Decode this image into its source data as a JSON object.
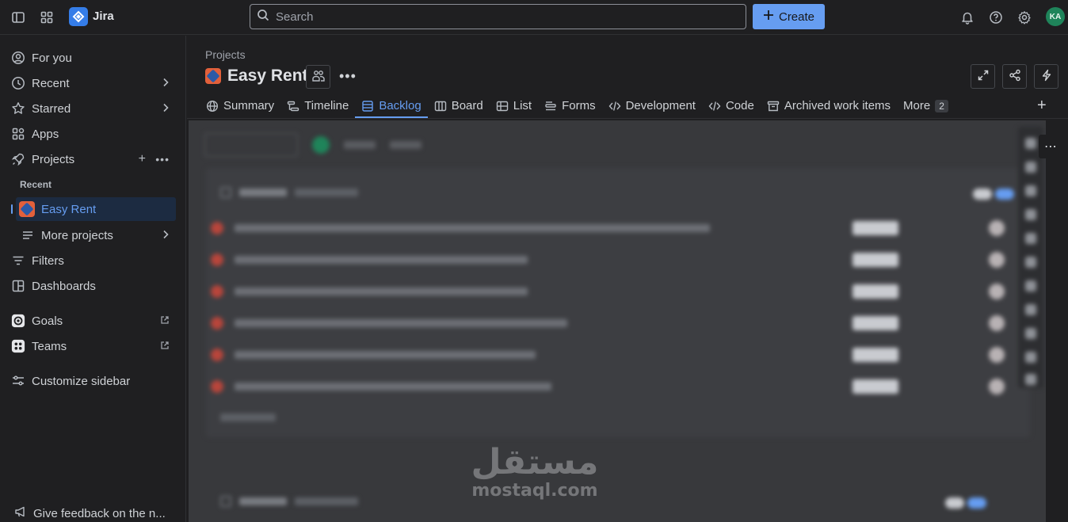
{
  "topbar": {
    "brand": "Jira",
    "search_placeholder": "Search",
    "create_label": "Create",
    "avatar_initials": "KA"
  },
  "sidebar": {
    "for_you": "For you",
    "recent": "Recent",
    "starred": "Starred",
    "apps": "Apps",
    "projects": "Projects",
    "recent_heading": "Recent",
    "easy_rent": "Easy Rent",
    "more_projects": "More projects",
    "filters": "Filters",
    "dashboards": "Dashboards",
    "goals": "Goals",
    "teams": "Teams",
    "customize": "Customize sidebar",
    "feedback": "Give feedback on the n..."
  },
  "header": {
    "breadcrumb": "Projects",
    "project_name": "Easy Rent"
  },
  "tabs": [
    {
      "label": "Summary",
      "icon": "globe-icon"
    },
    {
      "label": "Timeline",
      "icon": "timeline-icon"
    },
    {
      "label": "Backlog",
      "icon": "backlog-icon",
      "active": true
    },
    {
      "label": "Board",
      "icon": "board-icon"
    },
    {
      "label": "List",
      "icon": "list-icon"
    },
    {
      "label": "Forms",
      "icon": "forms-icon"
    },
    {
      "label": "Development",
      "icon": "code-icon"
    },
    {
      "label": "Code",
      "icon": "code-icon"
    },
    {
      "label": "Archived work items",
      "icon": "archive-icon"
    },
    {
      "label": "More",
      "icon": "",
      "count": "2"
    }
  ],
  "watermark": {
    "arabic": "مستقل",
    "latin": "mostaql.com"
  },
  "colors": {
    "accent": "#669df1",
    "avatar": "#1f845a",
    "project_icon": "#e2603b"
  }
}
